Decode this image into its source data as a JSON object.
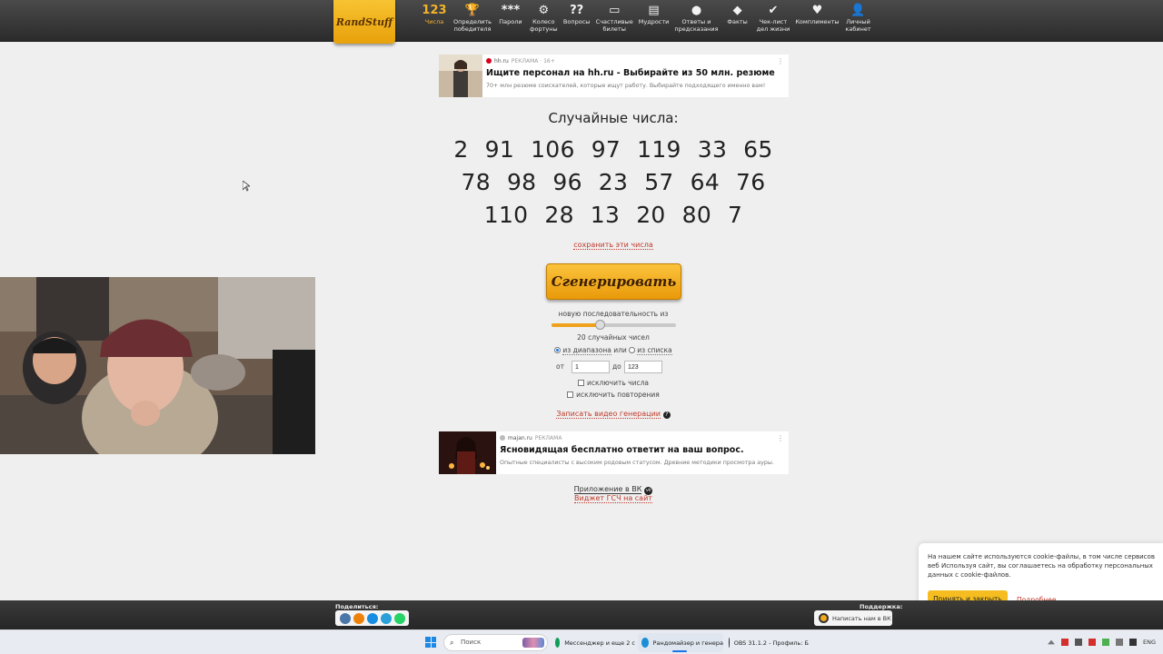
{
  "header": {
    "logo": "RandStuff",
    "nav": [
      {
        "icon_text": "123",
        "icon": "numbers-icon",
        "label": "Числа",
        "active": true
      },
      {
        "icon_text": "🏆",
        "icon": "trophy-icon",
        "label": "Определить\nпобедителя"
      },
      {
        "icon_text": "***",
        "icon": "password-icon",
        "label": "Пароли"
      },
      {
        "icon_text": "⚙",
        "icon": "wheel-icon",
        "label": "Колесо\nфортуны"
      },
      {
        "icon_text": "??",
        "icon": "questions-icon",
        "label": "Вопросы"
      },
      {
        "icon_text": "▭",
        "icon": "ticket-icon",
        "label": "Счастливые\nбилеты"
      },
      {
        "icon_text": "▤",
        "icon": "book-icon",
        "label": "Мудрости"
      },
      {
        "icon_text": "●",
        "icon": "magic-ball-icon",
        "label": "Ответы и\nпредсказания"
      },
      {
        "icon_text": "◆",
        "icon": "fact-icon",
        "label": "Факты"
      },
      {
        "icon_text": "✔",
        "icon": "checklist-icon",
        "label": "Чек-лист\nдел жизни"
      },
      {
        "icon_text": "♥",
        "icon": "heart-icon",
        "label": "Комплименты"
      },
      {
        "icon_text": "👤",
        "icon": "user-icon",
        "label": "Личный\nкабинет"
      }
    ]
  },
  "ad_top": {
    "source": "hh.ru",
    "tag": "РЕКЛАМА · 16+",
    "title": "Ищите персонал на hh.ru - Выбирайте из 50 млн. резюме",
    "desc": "70+ млн резюме соискателей, которые ищут работу. Выбирайте подходящего именно вам!",
    "menu": "⋮"
  },
  "main": {
    "title": "Случайные числа:",
    "rows": [
      [
        "2",
        "91",
        "106",
        "97",
        "119",
        "33",
        "65"
      ],
      [
        "78",
        "98",
        "96",
        "23",
        "57",
        "64",
        "76"
      ],
      [
        "110",
        "28",
        "13",
        "20",
        "80",
        "7"
      ]
    ],
    "save_link": "сохранить эти числа",
    "generate_button": "Сгенерировать",
    "sequence_label": "новую последовательность из",
    "slider_fraction": 0.39,
    "count_label": "20 случайных чисел",
    "range_option": "из диапазона",
    "or": "или",
    "list_option": "из списка",
    "from_label": "от",
    "from_value": "1",
    "to_label": "до",
    "to_value": "123",
    "exclude_numbers": "исключить числа",
    "exclude_repeats": "исключить повторения",
    "record_video": "Записать видео генерации",
    "app_link": "Приложение в ВК",
    "widget_link": "Виджет ГСЧ на сайт"
  },
  "ad_bottom": {
    "source": "majan.ru",
    "tag": "РЕКЛАМА",
    "title": "Ясновидящая бесплатно ответит на ваш вопрос.",
    "desc": "Опытные специалисты с высоким родовым статусом. Древние методики просмотра ауры.",
    "menu": "⋮"
  },
  "cookie": {
    "text": "На нашем сайте используются cookie-файлы, в том числе сервисов веб Используя сайт, вы соглашаетесь на обработку персональных данных с cookie-файлов.",
    "accept": "Принять и закрыть",
    "more": "Подробнее"
  },
  "footer": {
    "share_label": "Поделиться:",
    "support_label": "Поддержка:",
    "support_button": "Написать нам в ВК"
  },
  "taskbar": {
    "search": "Поиск",
    "tasks": [
      "Мессенджер и еще 2 с",
      "Рандомайзер и генера",
      "OBS 31.1.2 - Профиль: Б"
    ],
    "lang": "ENG"
  },
  "colors": {
    "accent": "#f1b32b",
    "link": "#c0392b",
    "button": "#f5bd1f"
  }
}
